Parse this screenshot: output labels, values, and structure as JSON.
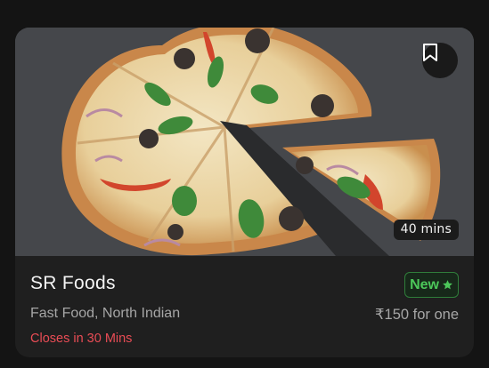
{
  "restaurant": {
    "name": "SR Foods",
    "cuisines": "Fast Food, North Indian",
    "status": "Closes in 30 Mins",
    "badge": "New",
    "price": "₹150 for one",
    "delivery_time": "40 mins"
  },
  "icons": {
    "bookmark": "bookmark-icon",
    "badge_star": "star-icon"
  },
  "colors": {
    "background": "#141414",
    "card": "#1f1f1f",
    "status_red": "#e94c55",
    "badge_green": "#4cc75a",
    "muted_text": "#a6a6a6"
  }
}
